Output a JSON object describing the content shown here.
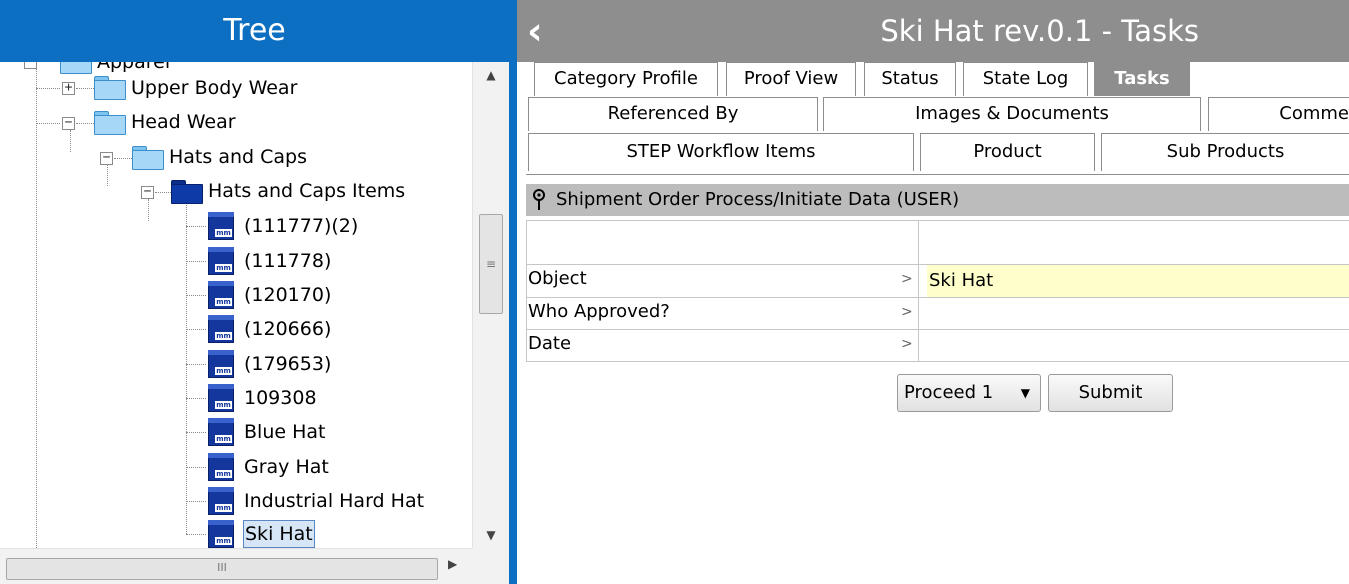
{
  "tree": {
    "title": "Tree",
    "nodes": [
      {
        "label": "Apparel"
      },
      {
        "label": "Upper Body Wear"
      },
      {
        "label": "Head Wear"
      },
      {
        "label": "Hats and Caps"
      },
      {
        "label": "Hats and Caps Items"
      },
      {
        "label": "(111777)(2)"
      },
      {
        "label": "(111778)"
      },
      {
        "label": "(120170)"
      },
      {
        "label": "(120666)"
      },
      {
        "label": "(179653)"
      },
      {
        "label": "109308"
      },
      {
        "label": "Blue Hat"
      },
      {
        "label": "Gray Hat"
      },
      {
        "label": "Industrial Hard Hat"
      },
      {
        "label": "Ski Hat"
      }
    ],
    "selected": "Ski Hat",
    "expand_symbols": {
      "plus": "+",
      "minus": "−"
    },
    "scroll_grip": "≡",
    "hscroll_grip": "III",
    "scroll_up": "▲",
    "scroll_down": "▼",
    "scroll_right": "▶"
  },
  "detail": {
    "back_icon": "‹",
    "title": "Ski Hat rev.0.1 - Tasks",
    "tabs_row1": [
      {
        "label": "Category Profile"
      },
      {
        "label": "Proof View"
      },
      {
        "label": "Status"
      },
      {
        "label": "State Log"
      },
      {
        "label": "Tasks"
      }
    ],
    "tabs_row2": [
      {
        "label": "Referenced By"
      },
      {
        "label": "Images & Documents"
      },
      {
        "label": "Comme"
      }
    ],
    "tabs_row3": [
      {
        "label": "STEP Workflow Items"
      },
      {
        "label": "Product"
      },
      {
        "label": "Sub Products"
      }
    ],
    "task": {
      "title": "Shipment Order Process/Initiate Data (USER)",
      "rows": [
        {
          "label": "Object",
          "value": "Ski Hat"
        },
        {
          "label": "Who Approved?",
          "value": ""
        },
        {
          "label": "Date",
          "value": ""
        }
      ],
      "row_arrow": ">",
      "proceed_value": "Proceed 1",
      "proceed_caret": "▼",
      "submit_label": "Submit"
    }
  },
  "colors": {
    "header_blue": "#0c6fc1",
    "header_gray": "#8e8e8e",
    "object_value_highlight": "#ffffcc",
    "folder_light": "#a6d7f7",
    "folder_dark": "#0e3aa8"
  },
  "icons": [
    "expander-icon",
    "folder-icon",
    "product-item-icon",
    "pin-icon",
    "back-arrow-icon",
    "dropdown-caret-icon"
  ]
}
